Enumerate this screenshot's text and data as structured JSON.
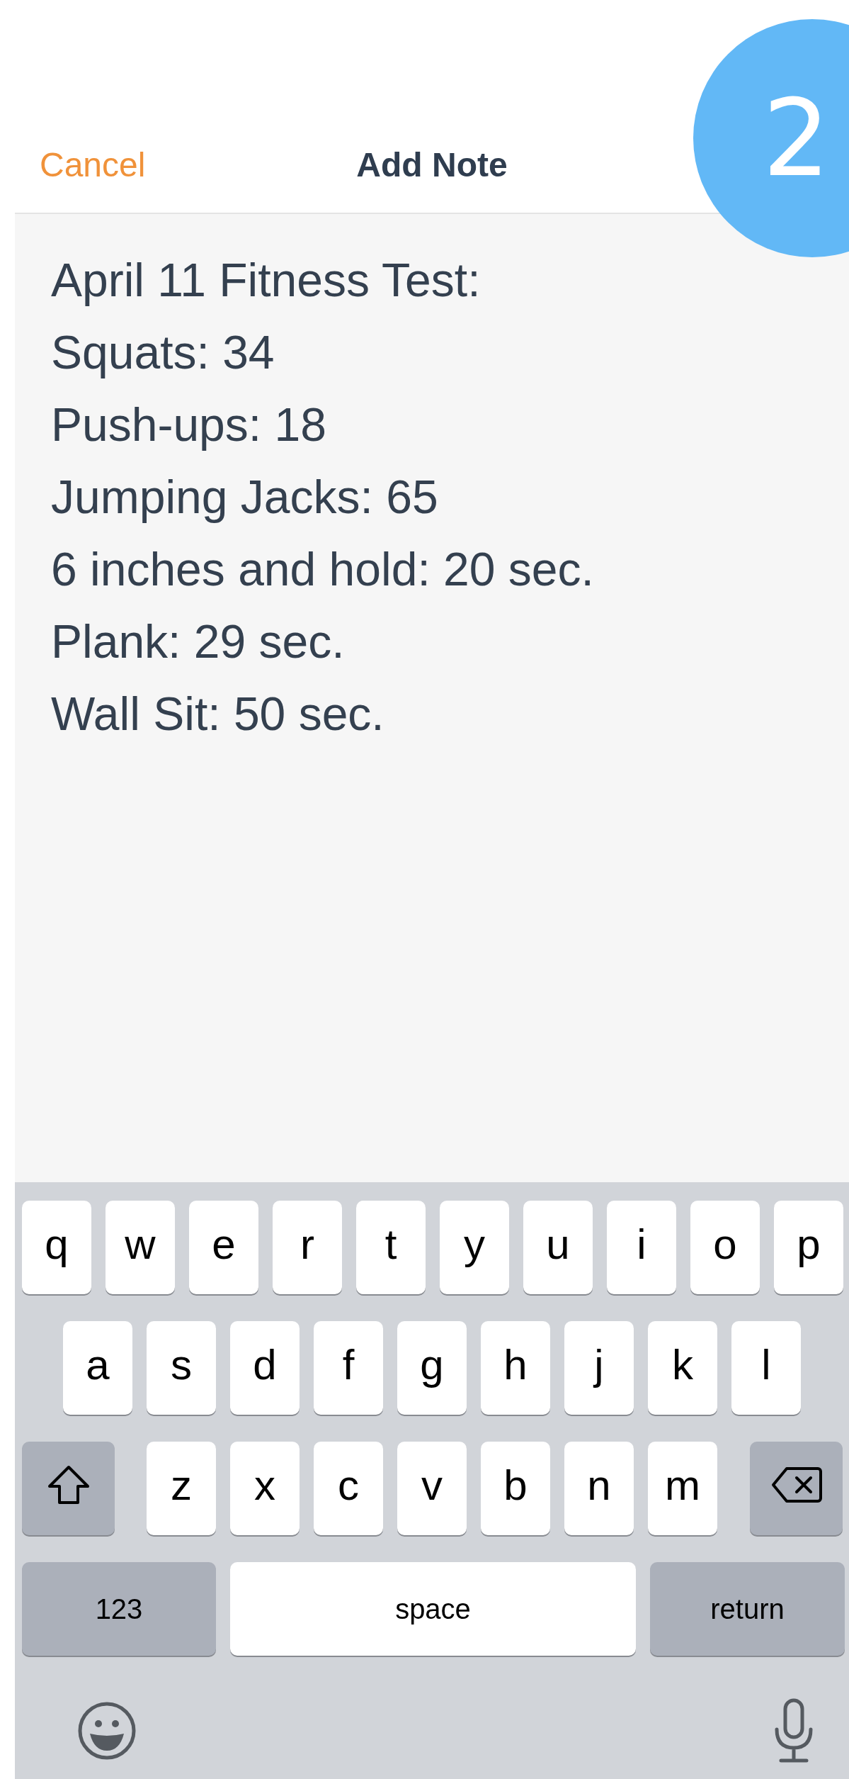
{
  "header": {
    "cancel": "Cancel",
    "title": "Add Note"
  },
  "badge": "2",
  "note": {
    "lines": [
      "April 11 Fitness Test:",
      "Squats: 34",
      "Push-ups: 18",
      "Jumping Jacks: 65",
      "6 inches and hold: 20 sec.",
      "Plank: 29 sec.",
      "Wall Sit: 50 sec."
    ]
  },
  "keyboard": {
    "rows": [
      [
        {
          "kind": "letter",
          "label": "q"
        },
        {
          "kind": "letter",
          "label": "w"
        },
        {
          "kind": "letter",
          "label": "e"
        },
        {
          "kind": "letter",
          "label": "r"
        },
        {
          "kind": "letter",
          "label": "t"
        },
        {
          "kind": "letter",
          "label": "y"
        },
        {
          "kind": "letter",
          "label": "u"
        },
        {
          "kind": "letter",
          "label": "i"
        },
        {
          "kind": "letter",
          "label": "o"
        },
        {
          "kind": "letter",
          "label": "p"
        }
      ],
      [
        {
          "kind": "letter",
          "label": "a"
        },
        {
          "kind": "letter",
          "label": "s"
        },
        {
          "kind": "letter",
          "label": "d"
        },
        {
          "kind": "letter",
          "label": "f"
        },
        {
          "kind": "letter",
          "label": "g"
        },
        {
          "kind": "letter",
          "label": "h"
        },
        {
          "kind": "letter",
          "label": "j"
        },
        {
          "kind": "letter",
          "label": "k"
        },
        {
          "kind": "letter",
          "label": "l"
        }
      ],
      [
        {
          "kind": "shift"
        },
        {
          "kind": "letter",
          "label": "z"
        },
        {
          "kind": "letter",
          "label": "x"
        },
        {
          "kind": "letter",
          "label": "c"
        },
        {
          "kind": "letter",
          "label": "v"
        },
        {
          "kind": "letter",
          "label": "b"
        },
        {
          "kind": "letter",
          "label": "n"
        },
        {
          "kind": "letter",
          "label": "m"
        },
        {
          "kind": "delete"
        }
      ]
    ],
    "bottom_row": {
      "numbers_key": "123",
      "space_key": "space",
      "return_key": "return"
    }
  }
}
